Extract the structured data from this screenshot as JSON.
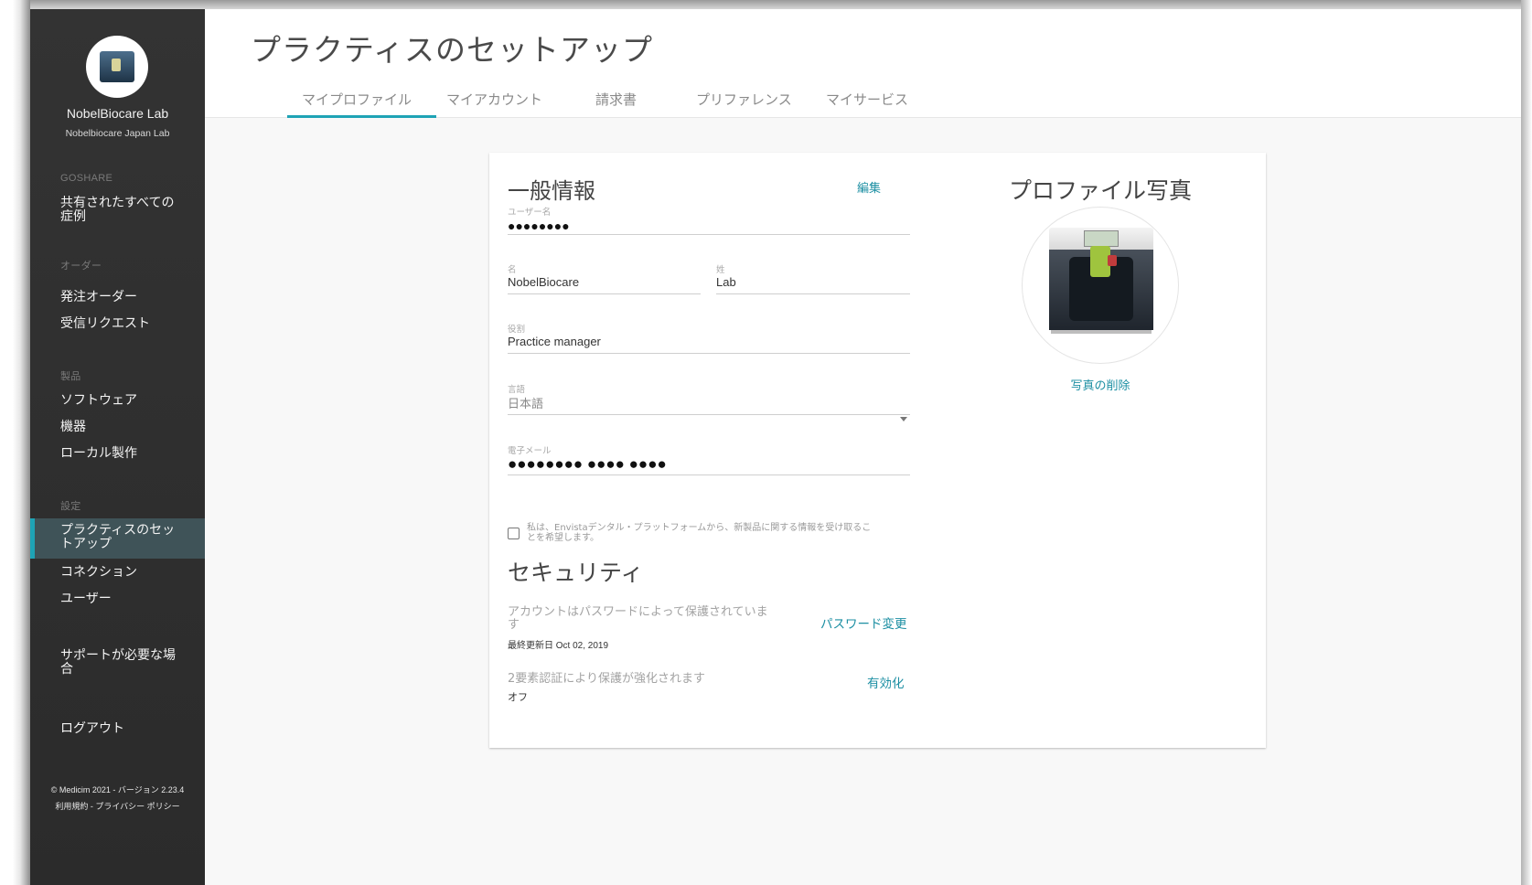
{
  "sidebar": {
    "lab_name": "NobelBiocare Lab",
    "lab_sub": "Nobelbiocare Japan Lab",
    "sections": [
      {
        "heading": "GOSHARE",
        "items": [
          {
            "label": "共有されたすべての\n症例"
          }
        ]
      },
      {
        "heading": "オーダー",
        "items": [
          {
            "label": "発注オーダー"
          },
          {
            "label": "受信リクエスト"
          }
        ]
      },
      {
        "heading": "製品",
        "items": [
          {
            "label": "ソフトウェア"
          },
          {
            "label": "機器"
          },
          {
            "label": "ローカル製作"
          }
        ]
      },
      {
        "heading": "設定",
        "items": [
          {
            "label": "プラクティスのセッ\nトアップ",
            "active": true
          },
          {
            "label": "コネクション"
          },
          {
            "label": "ユーザー"
          }
        ]
      }
    ],
    "support": "サポートが必要な場\n合",
    "logout": "ログアウト",
    "footer_copyright": "© Medicim 2021 - バージョン 2.23.4",
    "footer_links": "利用規約 - プライバシー ポリシー",
    "active_color": "#1ea3b5"
  },
  "header": {
    "title": "プラクティスのセットアップ",
    "tabs": [
      "マイプロファイル",
      "マイアカウント",
      "請求書",
      "プリファレンス",
      "マイサービス"
    ],
    "active_tab": "マイプロファイル"
  },
  "general": {
    "title": "一般情報",
    "edit": "編集",
    "username_label": "ユーザー名",
    "username_value": "●●●●●●●●",
    "first_label": "名",
    "first_value": "NobelBiocare",
    "last_label": "姓",
    "last_value": "Lab",
    "role_label": "役割",
    "role_value": "Practice manager",
    "language_label": "言語",
    "language_value": "日本語",
    "email_label": "電子メール",
    "email_value": "●●●●●●●● ●●●● ●●●●",
    "newsletter_text": "私は、Envistaデンタル・プラットフォームから、新製品に関する情報を受け取るこ\nとを希望します。",
    "newsletter_checked": false
  },
  "security": {
    "title": "セキュリティ",
    "password_text": "アカウントはパスワードによって保護されていま\nす",
    "password_updated": "最終更新日 Oct 02, 2019",
    "password_change": "パスワード変更",
    "twofa_text": "2要素認証により保護が強化されます",
    "twofa_status": "オフ",
    "twofa_enable": "有効化"
  },
  "photo": {
    "title": "プロファイル写真",
    "delete": "写真の削除"
  }
}
